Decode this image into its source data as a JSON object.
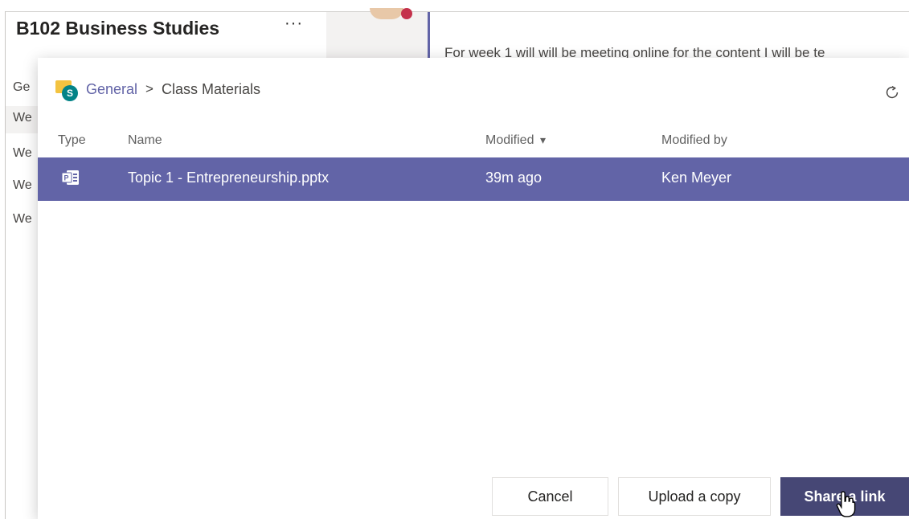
{
  "team": {
    "title": "B102 Business Studies",
    "more_label": "···",
    "channels": [
      "Ge",
      "We",
      "We",
      "We",
      "We"
    ]
  },
  "thread": {
    "text": "For week 1 will will be meeting online for the content I will be te"
  },
  "dialog": {
    "breadcrumb": {
      "root": "General",
      "separator": ">",
      "current": "Class Materials"
    },
    "columns": {
      "type": "Type",
      "name": "Name",
      "modified": "Modified",
      "modified_sort_indicator": "▾",
      "modified_by": "Modified by"
    },
    "files": [
      {
        "icon": "powerpoint-icon",
        "name": "Topic 1 - Entrepreneurship.pptx",
        "modified": "39m ago",
        "modified_by": "Ken Meyer",
        "selected": true
      }
    ],
    "buttons": {
      "cancel": "Cancel",
      "upload": "Upload a copy",
      "share": "Share a link"
    }
  },
  "colors": {
    "accent": "#6264a7",
    "primary_button": "#464775",
    "selected_row": "#6264a7"
  }
}
